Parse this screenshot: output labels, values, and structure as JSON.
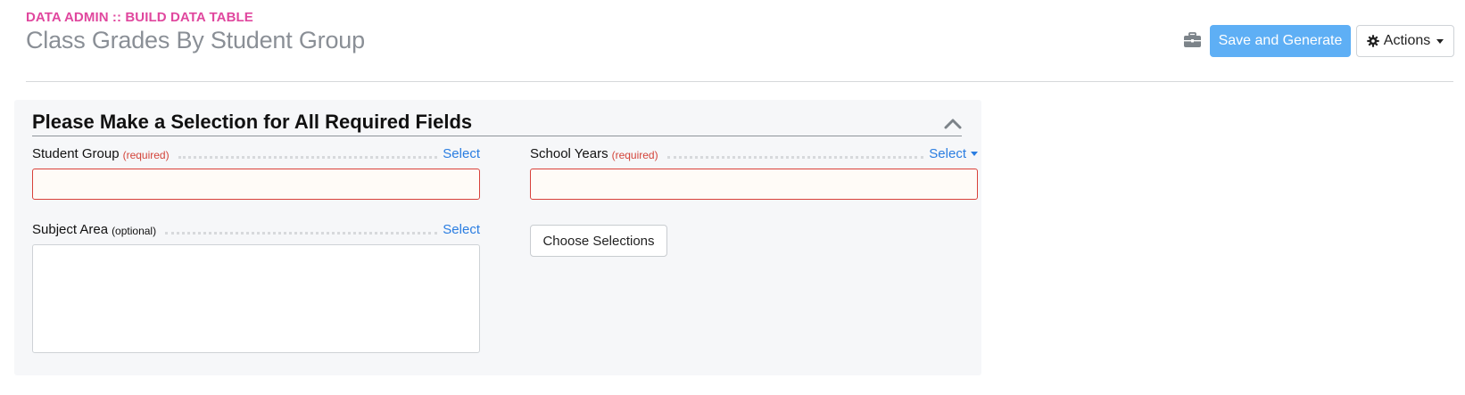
{
  "header": {
    "eyebrow": "DATA ADMIN :: BUILD DATA TABLE",
    "title": "Class Grades By Student Group",
    "briefcase_icon": "briefcase-icon",
    "save_label": "Save and Generate",
    "actions_label": "Actions",
    "actions_icon": "gear-icon"
  },
  "panel": {
    "title": "Please Make a Selection for All Required Fields",
    "collapse_icon": "chevron-up-icon",
    "fields": {
      "student_group": {
        "label": "Student Group",
        "qualifier": "(required)",
        "select_label": "Select",
        "value": ""
      },
      "school_years": {
        "label": "School Years",
        "qualifier": "(required)",
        "select_label": "Select",
        "value": ""
      },
      "subject_area": {
        "label": "Subject Area",
        "qualifier": "(optional)",
        "select_label": "Select",
        "value": ""
      }
    },
    "choose_label": "Choose Selections"
  },
  "colors": {
    "accent_pink": "#e0479e",
    "primary_button": "#5eaff5",
    "link_blue": "#2a7de1",
    "required_red": "#d9413a"
  }
}
